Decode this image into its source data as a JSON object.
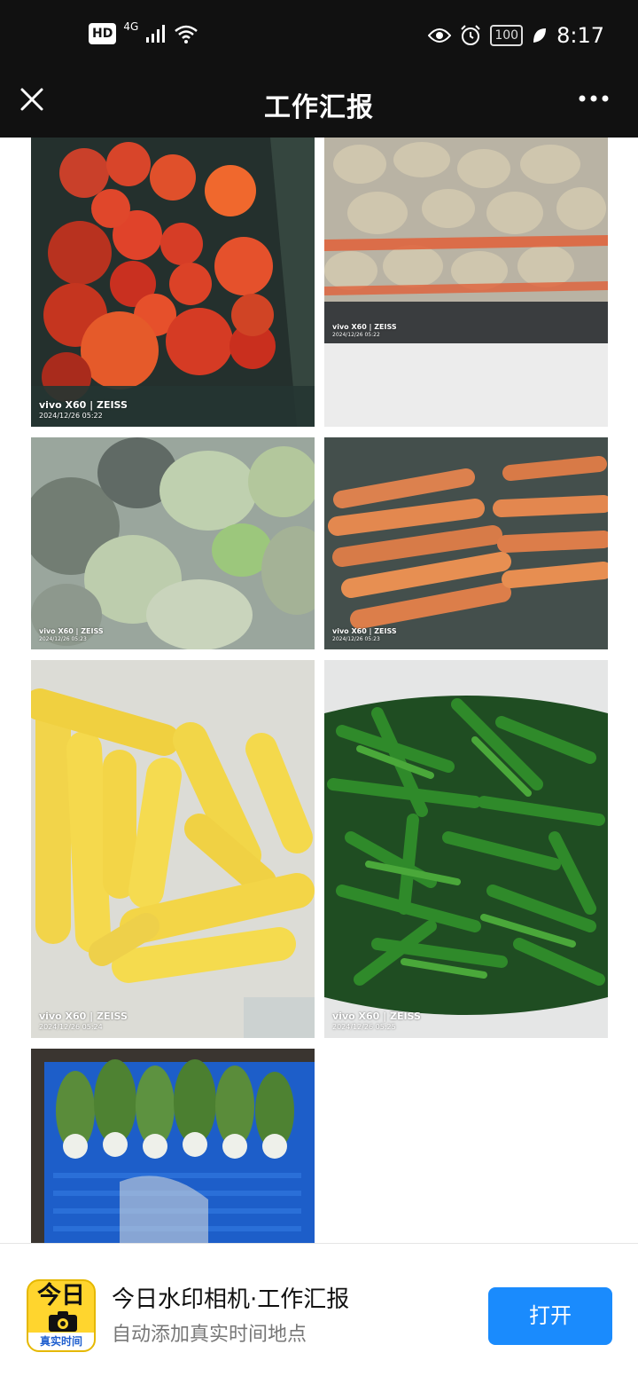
{
  "status_bar": {
    "hd": "HD",
    "network": "4G",
    "battery": "100",
    "time": "8:17",
    "icons": [
      "signal-icon",
      "wifi-icon",
      "eye-icon",
      "alarm-icon",
      "leaf-icon"
    ]
  },
  "header": {
    "title": "工作汇报",
    "close_icon": "close-icon",
    "more_icon": "more-icon"
  },
  "photos": [
    {
      "subject": "tomatoes",
      "brand": "vivo X60 | ZEISS",
      "date": "2024/12/26 05:22"
    },
    {
      "subject": "potatoes",
      "brand": "vivo X60 | ZEISS",
      "date": "2024/12/26 05:22"
    },
    {
      "subject": "cabbages",
      "brand": "vivo X60 | ZEISS",
      "date": "2024/12/26 05:23"
    },
    {
      "subject": "carrots",
      "brand": "vivo X60 | ZEISS",
      "date": "2024/12/26 05:23"
    },
    {
      "subject": "corn",
      "brand": "vivo X60 | ZEISS",
      "date": "2024/12/26 05:24"
    },
    {
      "subject": "green peppers",
      "brand": "vivo X60 | ZEISS",
      "date": "2024/12/26 05:25"
    },
    {
      "subject": "bok choy",
      "brand": "",
      "date": ""
    }
  ],
  "banner": {
    "logo_top": "今日",
    "logo_bottom": "真实时间",
    "app_name": "今日水印相机·工作汇报",
    "tagline": "自动添加真实时间地点",
    "open_label": "打开"
  },
  "colors": {
    "bar_bg": "#111111",
    "button_blue": "#1a8bfd",
    "logo_yellow": "#ffd52e"
  }
}
